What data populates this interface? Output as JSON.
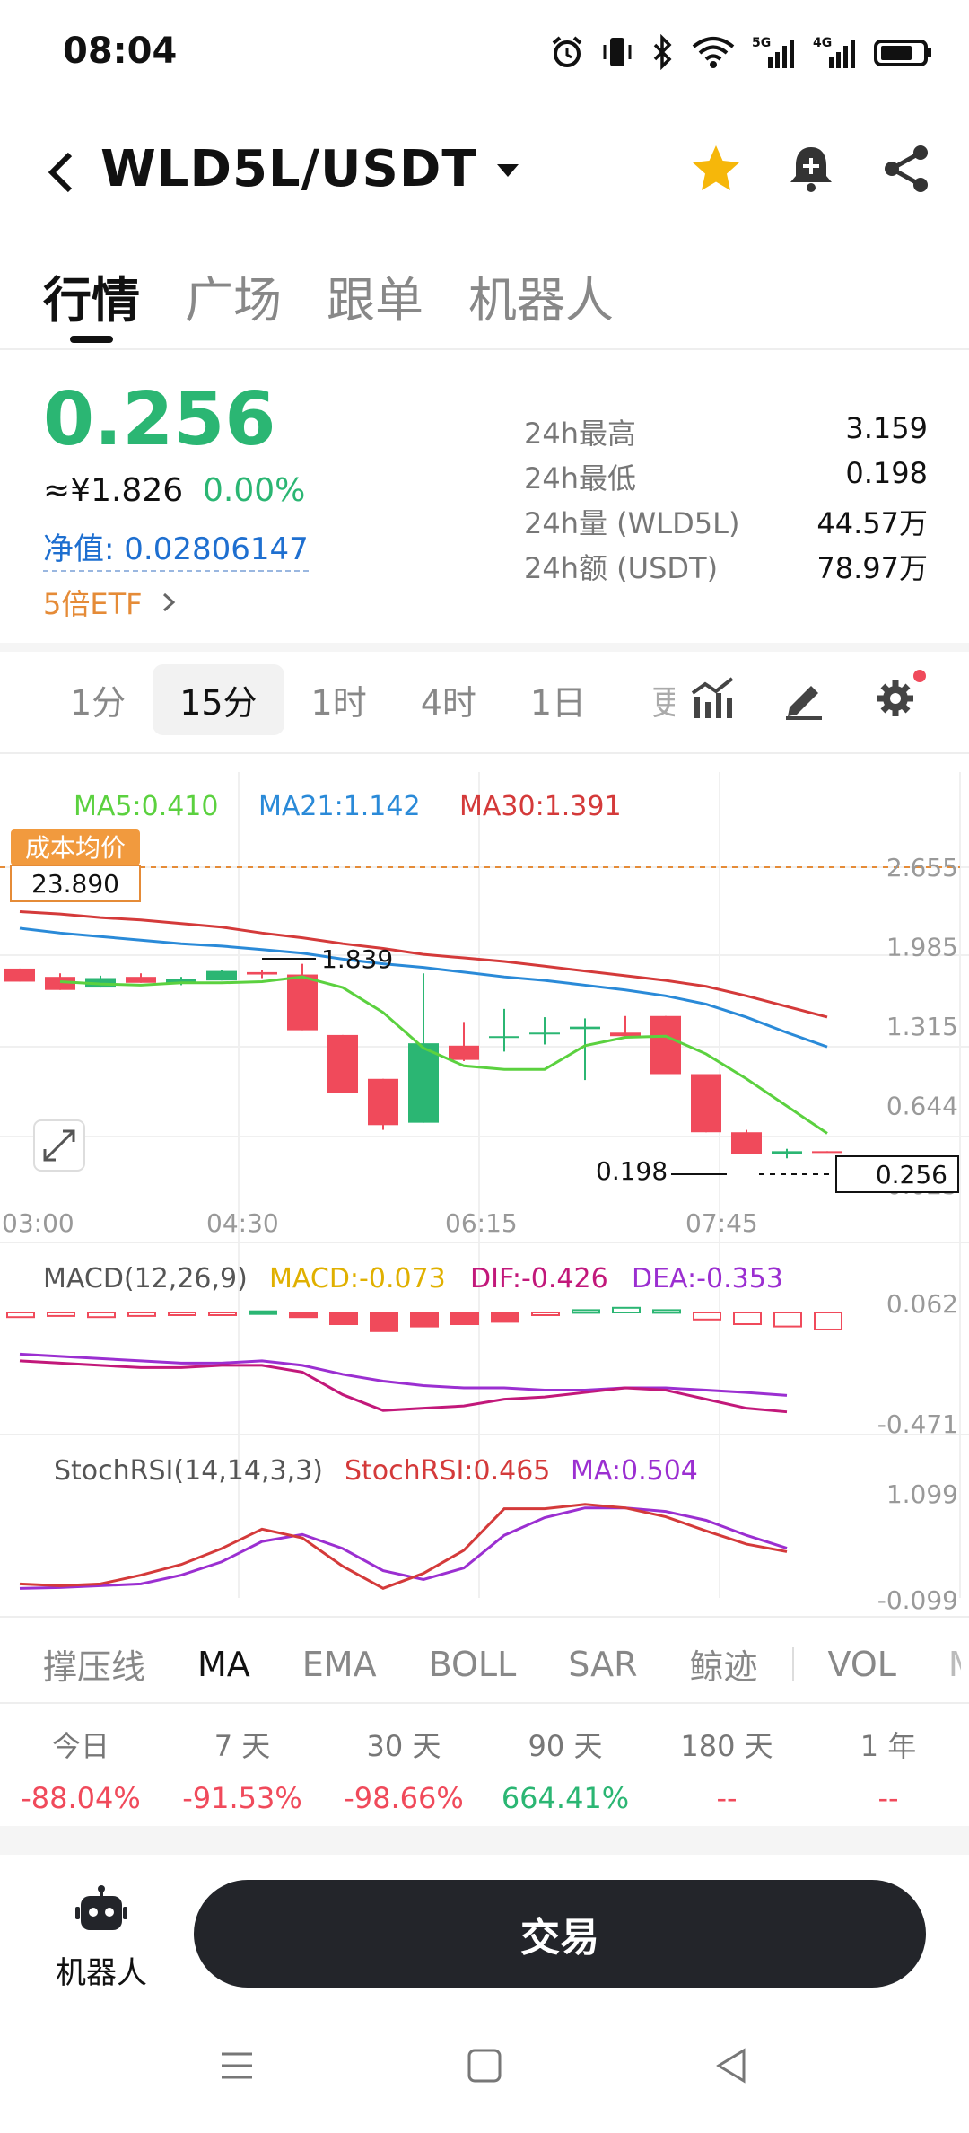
{
  "status": {
    "time": "08:04",
    "icons": [
      "alarm-icon",
      "vibrate-icon",
      "bluetooth-icon",
      "wifi-icon",
      "5g-signal-icon",
      "4g-signal-icon",
      "battery-icon"
    ],
    "net1": "5G",
    "net2": "4G"
  },
  "header": {
    "pair": "WLD5L/USDT",
    "icons": [
      "star-icon",
      "bell-icon",
      "share-icon"
    ]
  },
  "tabs": [
    "行情",
    "广场",
    "跟单",
    "机器人"
  ],
  "price": {
    "last": "0.256",
    "cny": "≈¥1.826",
    "change": "0.00%",
    "nav_label": "净值: 0.02806147",
    "etf_label": "5倍ETF",
    "stats": [
      {
        "k": "24h最高",
        "v": "3.159"
      },
      {
        "k": "24h最低",
        "v": "0.198"
      },
      {
        "k": "24h量 (WLD5L)",
        "v": "44.57万"
      },
      {
        "k": "24h额 (USDT)",
        "v": "78.97万"
      }
    ]
  },
  "timeframes": [
    "1分",
    "15分",
    "1时",
    "4时",
    "1日"
  ],
  "timeframe_cut": "更",
  "ma_legend": {
    "ma5": "MA5:0.410",
    "ma21": "MA21:1.142",
    "ma30": "MA30:1.391"
  },
  "cost": {
    "label": "成本均价",
    "value": "23.890"
  },
  "colors": {
    "up": "#2bb673",
    "down": "#f04a5b",
    "ma5": "#5bd13f",
    "ma21": "#2a8ad8",
    "ma30": "#d43a3a",
    "macd_label": "#e0b000",
    "dif": "#c2187a",
    "dea": "#9b2fd1",
    "rsi": "#d43a3a",
    "rsi_ma": "#9b2fd1",
    "cost": "#e58b37"
  },
  "chart_data": {
    "type": "candlestick",
    "price_axis": [
      "2.655",
      "1.985",
      "1.315",
      "0.644",
      "-0.025"
    ],
    "time_axis": [
      "03:00",
      "04:30",
      "06:15",
      "07:45"
    ],
    "annotations": {
      "high": "1.839",
      "low": "0.198",
      "current": "0.256"
    },
    "candles": [
      {
        "o": 1.8,
        "h": 1.8,
        "l": 1.69,
        "c": 1.69
      },
      {
        "o": 1.73,
        "h": 1.76,
        "l": 1.62,
        "c": 1.62
      },
      {
        "o": 1.64,
        "h": 1.74,
        "l": 1.64,
        "c": 1.72
      },
      {
        "o": 1.73,
        "h": 1.76,
        "l": 1.68,
        "c": 1.68
      },
      {
        "o": 1.68,
        "h": 1.73,
        "l": 1.66,
        "c": 1.71
      },
      {
        "o": 1.7,
        "h": 1.79,
        "l": 1.7,
        "c": 1.78
      },
      {
        "o": 1.77,
        "h": 1.79,
        "l": 1.72,
        "c": 1.75
      },
      {
        "o": 1.75,
        "h": 1.84,
        "l": 1.28,
        "c": 1.28
      },
      {
        "o": 1.24,
        "h": 1.24,
        "l": 0.75,
        "c": 0.75
      },
      {
        "o": 0.87,
        "h": 0.87,
        "l": 0.44,
        "c": 0.48
      },
      {
        "o": 0.5,
        "h": 1.76,
        "l": 0.5,
        "c": 1.17
      },
      {
        "o": 1.15,
        "h": 1.35,
        "l": 1.02,
        "c": 1.03
      },
      {
        "o": 1.23,
        "h": 1.46,
        "l": 1.1,
        "c": 1.23
      },
      {
        "o": 1.26,
        "h": 1.39,
        "l": 1.16,
        "c": 1.26
      },
      {
        "o": 1.29,
        "h": 1.38,
        "l": 0.86,
        "c": 1.31
      },
      {
        "o": 1.26,
        "h": 1.4,
        "l": 1.21,
        "c": 1.23
      },
      {
        "o": 1.4,
        "h": 1.4,
        "l": 0.91,
        "c": 0.91
      },
      {
        "o": 0.91,
        "h": 0.91,
        "l": 0.42,
        "c": 0.42
      },
      {
        "o": 0.42,
        "h": 0.44,
        "l": 0.24,
        "c": 0.24
      },
      {
        "o": 0.24,
        "h": 0.28,
        "l": 0.2,
        "c": 0.26
      },
      {
        "o": 0.26,
        "h": 0.26,
        "l": 0.25,
        "c": 0.256
      }
    ],
    "ma5": [
      1.69,
      1.67,
      1.66,
      1.68,
      1.68,
      1.69,
      1.73,
      1.64,
      1.43,
      1.13,
      0.98,
      0.95,
      0.95,
      1.15,
      1.22,
      1.23,
      1.08,
      0.87,
      0.64,
      0.41
    ],
    "ma21": [
      2.14,
      2.1,
      2.07,
      2.04,
      2.01,
      1.99,
      1.96,
      1.93,
      1.88,
      1.84,
      1.81,
      1.77,
      1.73,
      1.7,
      1.66,
      1.62,
      1.57,
      1.5,
      1.39,
      1.26,
      1.14
    ],
    "ma30": [
      2.28,
      2.26,
      2.23,
      2.21,
      2.18,
      2.15,
      2.1,
      2.06,
      2.01,
      1.97,
      1.92,
      1.89,
      1.86,
      1.82,
      1.78,
      1.74,
      1.7,
      1.65,
      1.57,
      1.48,
      1.391
    ],
    "macd": {
      "legend": "MACD(12,26,9)",
      "macd": "MACD:-0.073",
      "dif": "DIF:-0.426",
      "dea": "DEA:-0.353",
      "axis": [
        "0.062",
        "-0.471"
      ],
      "hist": [
        -0.02,
        -0.015,
        -0.02,
        -0.015,
        -0.01,
        -0.005,
        0.005,
        -0.02,
        -0.05,
        -0.08,
        -0.06,
        -0.05,
        -0.04,
        -0.01,
        0.01,
        0.02,
        0.01,
        -0.03,
        -0.05,
        -0.06,
        -0.073
      ],
      "dif_line": [
        -0.2,
        -0.21,
        -0.22,
        -0.23,
        -0.23,
        -0.22,
        -0.22,
        -0.25,
        -0.35,
        -0.42,
        -0.41,
        -0.4,
        -0.37,
        -0.36,
        -0.34,
        -0.32,
        -0.33,
        -0.37,
        -0.41,
        -0.426
      ],
      "dea_line": [
        -0.17,
        -0.18,
        -0.19,
        -0.2,
        -0.21,
        -0.21,
        -0.2,
        -0.22,
        -0.26,
        -0.29,
        -0.31,
        -0.32,
        -0.32,
        -0.33,
        -0.33,
        -0.32,
        -0.32,
        -0.33,
        -0.34,
        -0.353
      ]
    },
    "stochrsi": {
      "legend": "StochRSI(14,14,3,3)",
      "k": "StochRSI:0.465",
      "ma": "MA:0.504",
      "axis": [
        "1.099",
        "-0.099"
      ],
      "k_line": [
        0.1,
        0.08,
        0.1,
        0.2,
        0.32,
        0.5,
        0.72,
        0.62,
        0.3,
        0.05,
        0.22,
        0.48,
        0.95,
        0.95,
        1.0,
        0.96,
        0.86,
        0.7,
        0.55,
        0.465
      ],
      "ma_line": [
        0.05,
        0.06,
        0.08,
        0.1,
        0.2,
        0.35,
        0.58,
        0.66,
        0.5,
        0.25,
        0.15,
        0.28,
        0.65,
        0.85,
        0.96,
        0.96,
        0.92,
        0.82,
        0.65,
        0.504
      ]
    }
  },
  "indicators": [
    "撑压线",
    "MA",
    "EMA",
    "BOLL",
    "SAR",
    "鲸迹",
    "VOL"
  ],
  "indicator_cut": "M",
  "performance": [
    {
      "p": "今日",
      "v": "-88.04%",
      "c": "down"
    },
    {
      "p": "7 天",
      "v": "-91.53%",
      "c": "down"
    },
    {
      "p": "30 天",
      "v": "-98.66%",
      "c": "down"
    },
    {
      "p": "90 天",
      "v": "664.41%",
      "c": "up"
    },
    {
      "p": "180 天",
      "v": "--",
      "c": "down"
    },
    {
      "p": "1 年",
      "v": "--",
      "c": "down"
    }
  ],
  "bottom": {
    "robot": "机器人",
    "trade": "交易"
  }
}
